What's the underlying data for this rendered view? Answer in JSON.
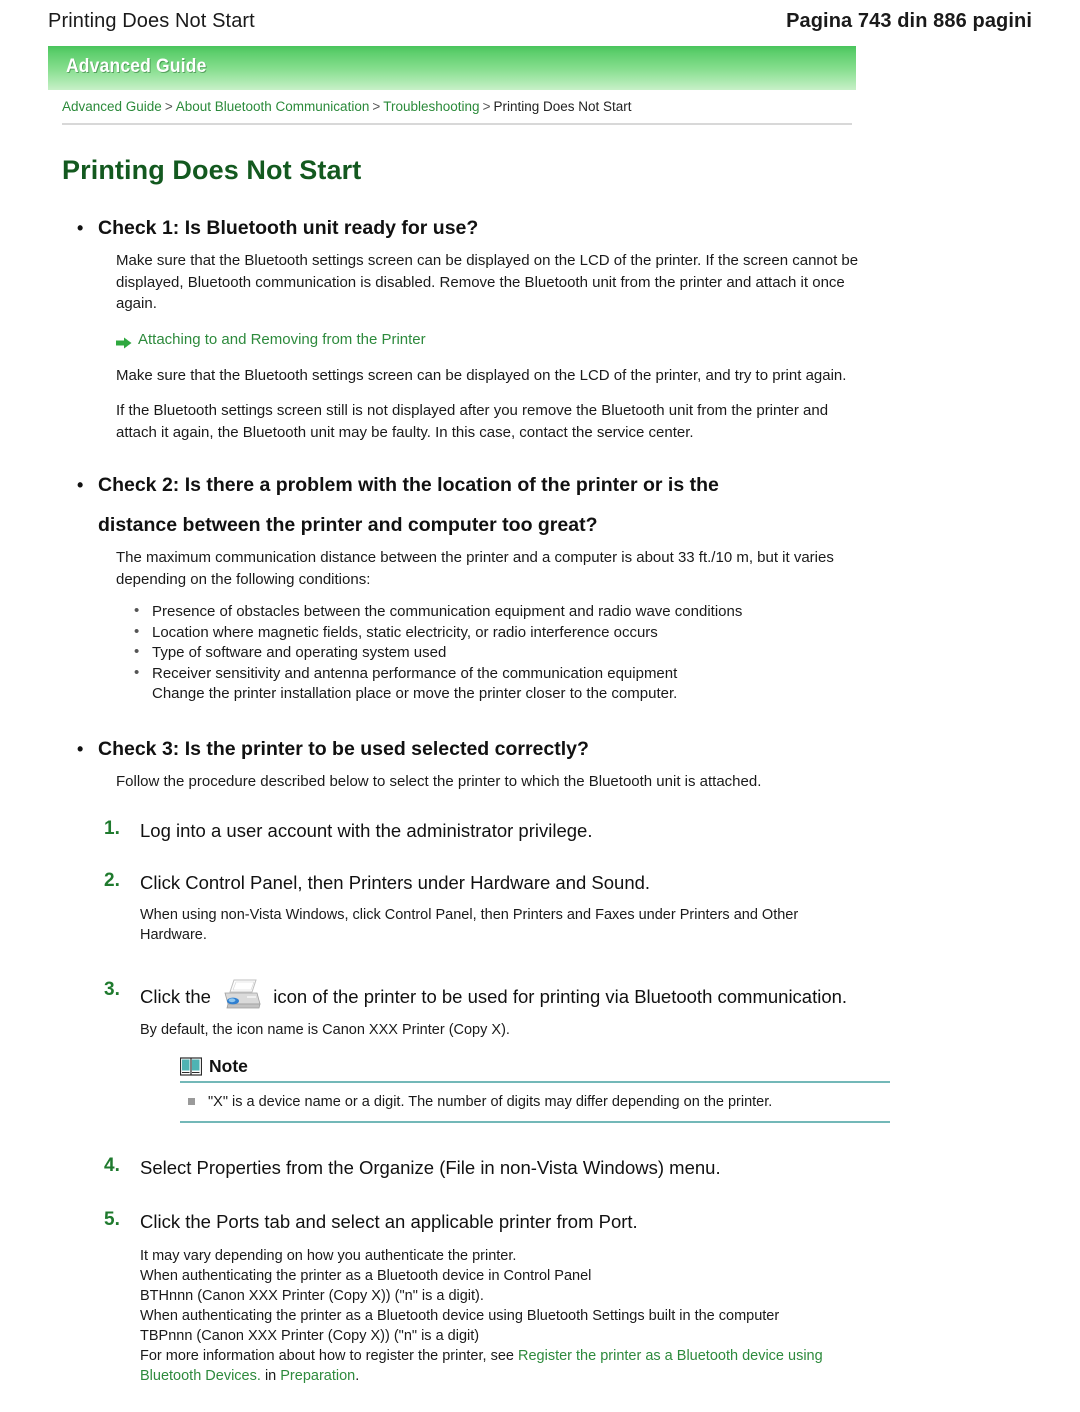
{
  "header": {
    "doc_title": "Printing Does Not Start",
    "page_count": "Pagina 743 din 886 pagini"
  },
  "banner": {
    "title": "Advanced Guide"
  },
  "breadcrumb": {
    "items": [
      {
        "label": "Advanced Guide",
        "link": true
      },
      {
        "label": "About Bluetooth Communication",
        "link": true
      },
      {
        "label": "Troubleshooting",
        "link": true
      },
      {
        "label": "Printing Does Not Start",
        "link": false
      }
    ],
    "separator": ">"
  },
  "page": {
    "title": "Printing Does Not Start"
  },
  "check1": {
    "heading": "Check 1: Is Bluetooth unit ready for use?",
    "para1": "Make sure that the Bluetooth settings screen can be displayed on the LCD of the printer. If the screen cannot be displayed, Bluetooth communication is disabled. Remove the Bluetooth unit from the printer and attach it once again.",
    "link": "Attaching to and Removing from the Printer",
    "para2": "Make sure that the Bluetooth settings screen can be displayed on the LCD of the printer, and try to print again.",
    "para3": "If the Bluetooth settings screen still is not displayed after you remove the Bluetooth unit from the printer and attach it again, the Bluetooth unit may be faulty. In this case, contact the service center."
  },
  "check2": {
    "heading_line1": "Check 2: Is there a problem with the location of the printer or is the",
    "heading_line2": "distance between the printer and computer too great?",
    "para1": "The maximum communication distance between the printer and a computer is about 33 ft./10 m, but it varies depending on the following conditions:",
    "conditions": [
      "Presence of obstacles between the communication equipment and radio wave conditions",
      "Location where magnetic fields, static electricity, or radio interference occurs",
      "Type of software and operating system used",
      "Receiver sensitivity and antenna performance of the communication equipment"
    ],
    "conditions_last_sub": "Change the printer installation place or move the printer closer to the computer."
  },
  "check3": {
    "heading": "Check 3: Is the printer to be used selected correctly?",
    "para1": "Follow the procedure described below to select the printer to which the Bluetooth unit is attached.",
    "steps": [
      {
        "num": "1.",
        "title": "Log into a user account with the administrator privilege.",
        "sub": []
      },
      {
        "num": "2.",
        "title": "Click Control Panel, then Printers under Hardware and Sound.",
        "sub": [
          "When using non-Vista Windows, click Control Panel, then Printers and Faxes under Printers and Other Hardware."
        ]
      },
      {
        "num": "3.",
        "title_pre": "Click the",
        "title_post": "icon of the printer to be used for printing via Bluetooth communication.",
        "sub": [
          "By default, the icon name is Canon XXX Printer (Copy X)."
        ]
      },
      {
        "num": "4.",
        "title": "Select Properties from the Organize (File in non-Vista Windows) menu.",
        "sub": []
      },
      {
        "num": "5.",
        "title": "Click the Ports tab and select an applicable printer from Port.",
        "sub": []
      }
    ]
  },
  "note": {
    "label": "Note",
    "items": [
      "\"X\" is a device name or a digit. The number of digits may differ depending on the printer."
    ]
  },
  "final": {
    "line1": "It may vary depending on how you authenticate the printer.",
    "line2": "When authenticating the printer as a Bluetooth device in Control Panel",
    "line3": "BTHnnn (Canon XXX Printer (Copy X)) (\"n\" is a digit).",
    "line4": "When authenticating the printer as a Bluetooth device using Bluetooth Settings built in the computer",
    "line5": "TBPnnn (Canon XXX Printer (Copy X)) (\"n\" is a digit)",
    "line6_pre": "For more information about how to register the printer, see",
    "link1": "Register the printer as a Bluetooth device using Bluetooth Devices.",
    "line6_mid": "in",
    "link2": "Preparation",
    "line6_end": "."
  },
  "colors": {
    "brand_green": "#2d8a3c",
    "title_green": "#13591f",
    "banner_green": "#49c45c",
    "note_teal": "#73b8b8",
    "step_number_green": "#1f7a2e"
  },
  "icons": {
    "arrow": "arrow-right-icon",
    "printer": "printer-icon",
    "note": "book-icon"
  }
}
